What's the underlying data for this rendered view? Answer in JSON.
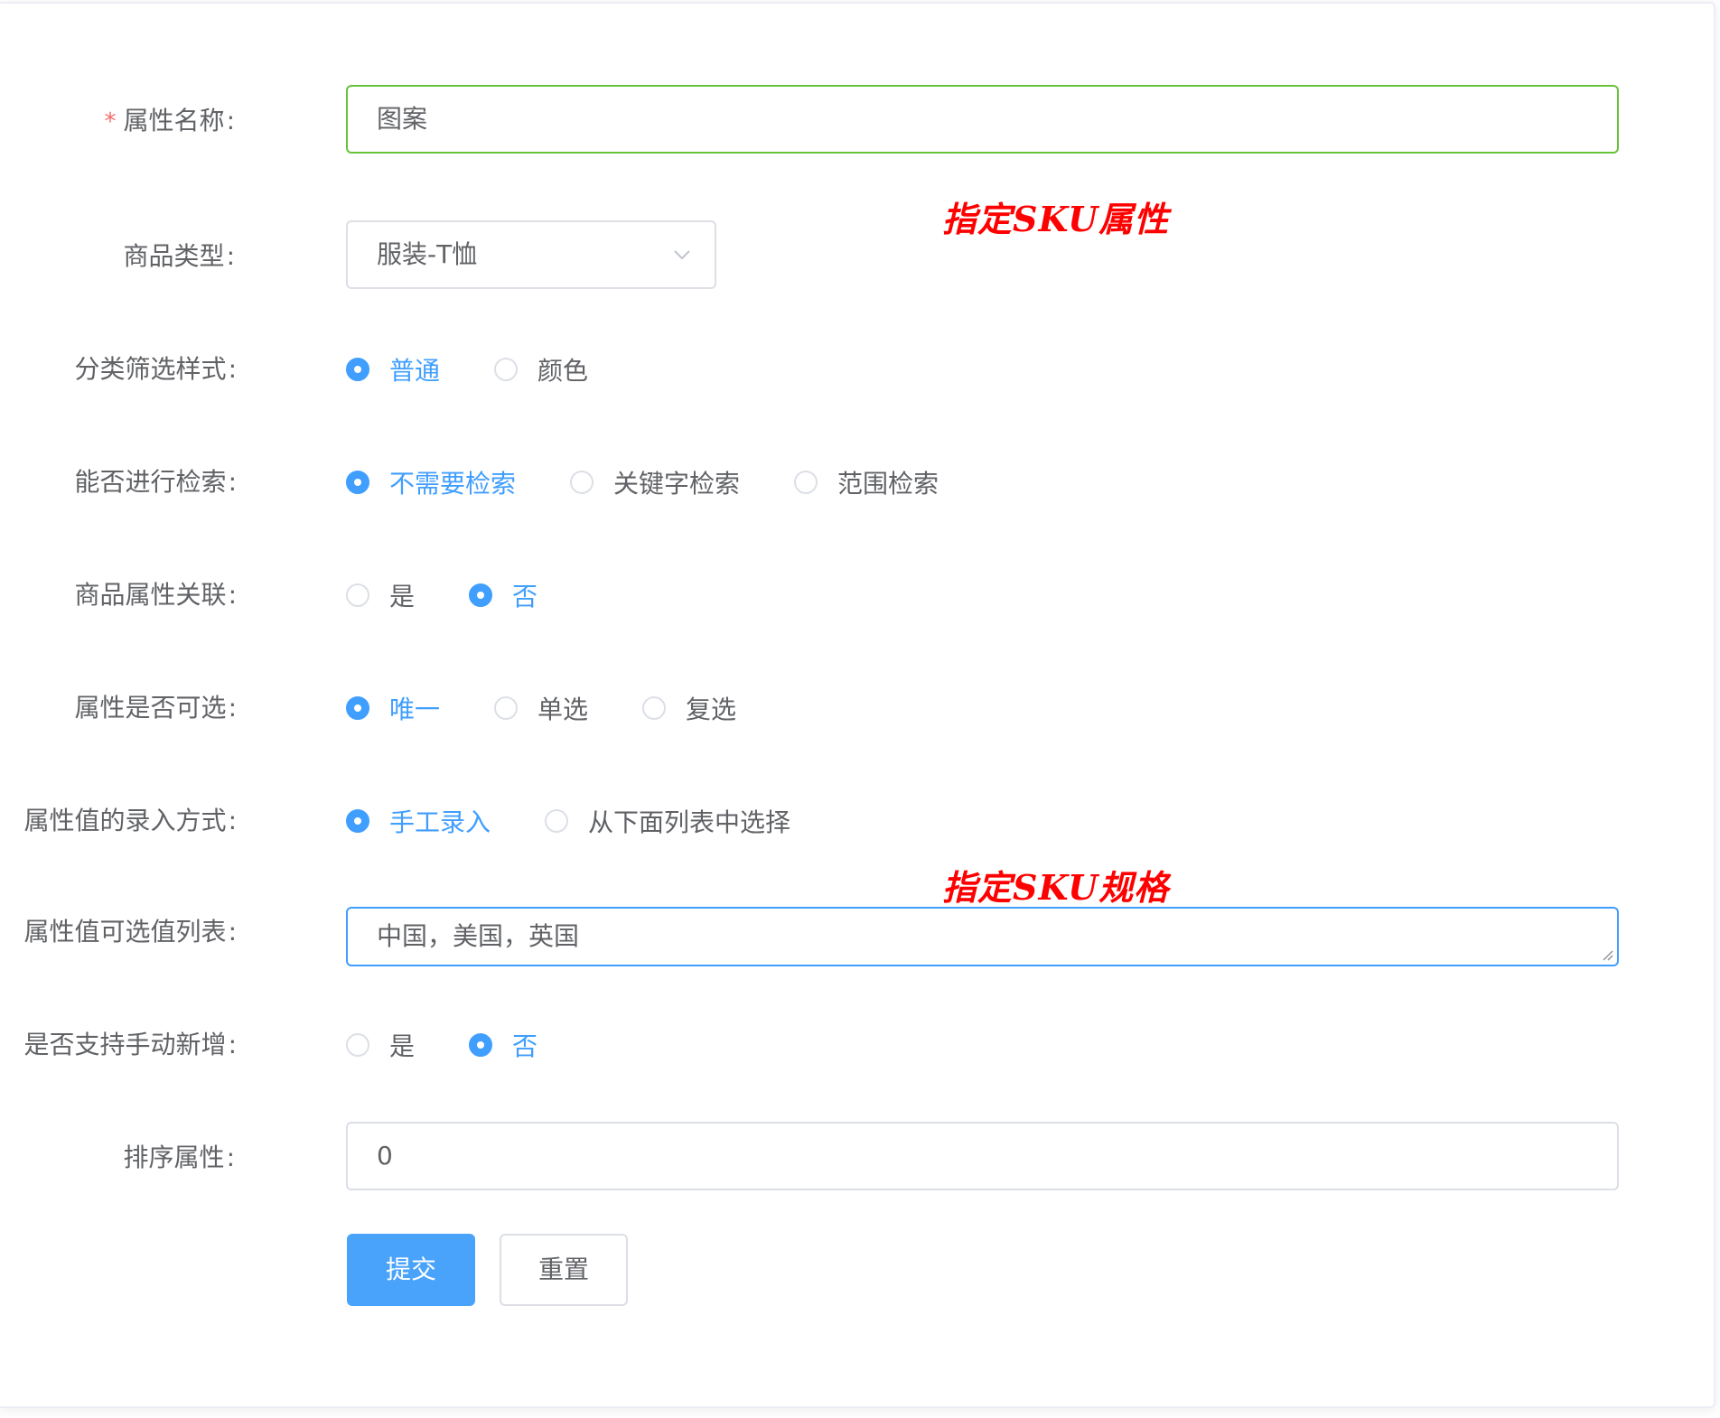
{
  "form": {
    "attr_name": {
      "label": "属性名称",
      "required_mark": "*",
      "value": "图案"
    },
    "product_type": {
      "label": "商品类型",
      "value": "服装-T恤"
    },
    "filter_style": {
      "label": "分类筛选样式",
      "options": [
        "普通",
        "颜色"
      ],
      "selected": "普通"
    },
    "searchable": {
      "label": "能否进行检索",
      "options": [
        "不需要检索",
        "关键字检索",
        "范围检索"
      ],
      "selected": "不需要检索"
    },
    "relation": {
      "label": "商品属性关联",
      "options": [
        "是",
        "否"
      ],
      "selected": "否"
    },
    "selectable": {
      "label": "属性是否可选",
      "options": [
        "唯一",
        "单选",
        "复选"
      ],
      "selected": "唯一"
    },
    "input_mode": {
      "label": "属性值的录入方式",
      "options": [
        "手工录入",
        "从下面列表中选择"
      ],
      "selected": "手工录入"
    },
    "value_list": {
      "label": "属性值可选值列表",
      "value": "中国，美国，英国"
    },
    "manual_add": {
      "label": "是否支持手动新增",
      "options": [
        "是",
        "否"
      ],
      "selected": "否"
    },
    "sort": {
      "label": "排序属性",
      "value": "0"
    },
    "submit_label": "提交",
    "reset_label": "重置"
  },
  "annotations": {
    "sku_attr": "指定SKU属性",
    "sku_spec": "指定SKU规格"
  },
  "colors": {
    "primary": "#409eff",
    "success_border": "#67c23a",
    "annotation": "#ff0000",
    "required": "#f56c6c"
  }
}
